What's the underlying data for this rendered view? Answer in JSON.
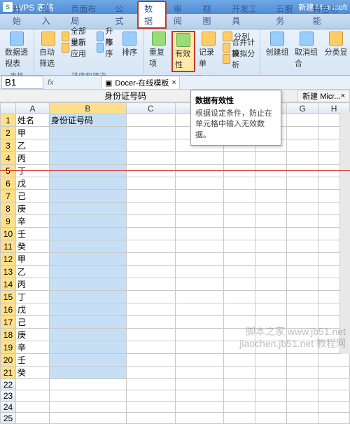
{
  "app": {
    "name": "WPS 表格",
    "doc": "新建 Microsoft"
  },
  "tabs": [
    "开始",
    "插入",
    "页面布局",
    "公式",
    "数据",
    "审阅",
    "视图",
    "开发工具",
    "云服务",
    "特色功能"
  ],
  "active_tab": 4,
  "ribbon": {
    "g1": {
      "title": "表格",
      "b1": "数据透视表"
    },
    "g2": {
      "title": "排序和筛选",
      "b1": "自动筛选",
      "b2": "全部显示",
      "b3": "重新应用",
      "b4": "升序",
      "b5": "降序",
      "b6": "排序"
    },
    "g3": {
      "title": "数据工具",
      "b1": "重复项",
      "b2": "有效性",
      "b3": "记录单",
      "b4": "分列",
      "b5": "合并计算",
      "b6": "模拟分析"
    },
    "g4": {
      "b1": "创建组",
      "b2": "取消组合",
      "b3": "分类显"
    }
  },
  "namebox": "B1",
  "formula": "身份证号码",
  "docer_tab": "Docer-在线模板",
  "sheet_tab": "新建 Micr...",
  "tooltip": {
    "title": "数据有效性",
    "body": "根据设定条件，防止在单元格中输入无效数据。"
  },
  "cols": [
    "A",
    "B",
    "C",
    "D",
    "E",
    "F",
    "G",
    "H"
  ],
  "rows": [
    {
      "n": 1,
      "a": "姓名",
      "b": "身份证号码"
    },
    {
      "n": 2,
      "a": "甲",
      "b": ""
    },
    {
      "n": 3,
      "a": "乙",
      "b": ""
    },
    {
      "n": 4,
      "a": "丙",
      "b": ""
    },
    {
      "n": 5,
      "a": "丁",
      "b": ""
    },
    {
      "n": 6,
      "a": "戊",
      "b": ""
    },
    {
      "n": 7,
      "a": "己",
      "b": ""
    },
    {
      "n": 8,
      "a": "庚",
      "b": ""
    },
    {
      "n": 9,
      "a": "辛",
      "b": ""
    },
    {
      "n": 10,
      "a": "壬",
      "b": ""
    },
    {
      "n": 11,
      "a": "癸",
      "b": ""
    },
    {
      "n": 12,
      "a": "甲",
      "b": ""
    },
    {
      "n": 13,
      "a": "乙",
      "b": ""
    },
    {
      "n": 14,
      "a": "丙",
      "b": ""
    },
    {
      "n": 15,
      "a": "丁",
      "b": ""
    },
    {
      "n": 16,
      "a": "戊",
      "b": ""
    },
    {
      "n": 17,
      "a": "己",
      "b": ""
    },
    {
      "n": 18,
      "a": "庚",
      "b": ""
    },
    {
      "n": 19,
      "a": "辛",
      "b": ""
    },
    {
      "n": 20,
      "a": "壬",
      "b": ""
    },
    {
      "n": 21,
      "a": "癸",
      "b": ""
    },
    {
      "n": 22,
      "a": "",
      "b": ""
    },
    {
      "n": 23,
      "a": "",
      "b": ""
    },
    {
      "n": 24,
      "a": "",
      "b": ""
    },
    {
      "n": 25,
      "a": "",
      "b": ""
    }
  ],
  "wm": {
    "l1": "脚本之家 www.jb51.net",
    "l2": "jiaochen.jb51.net 教程网"
  }
}
